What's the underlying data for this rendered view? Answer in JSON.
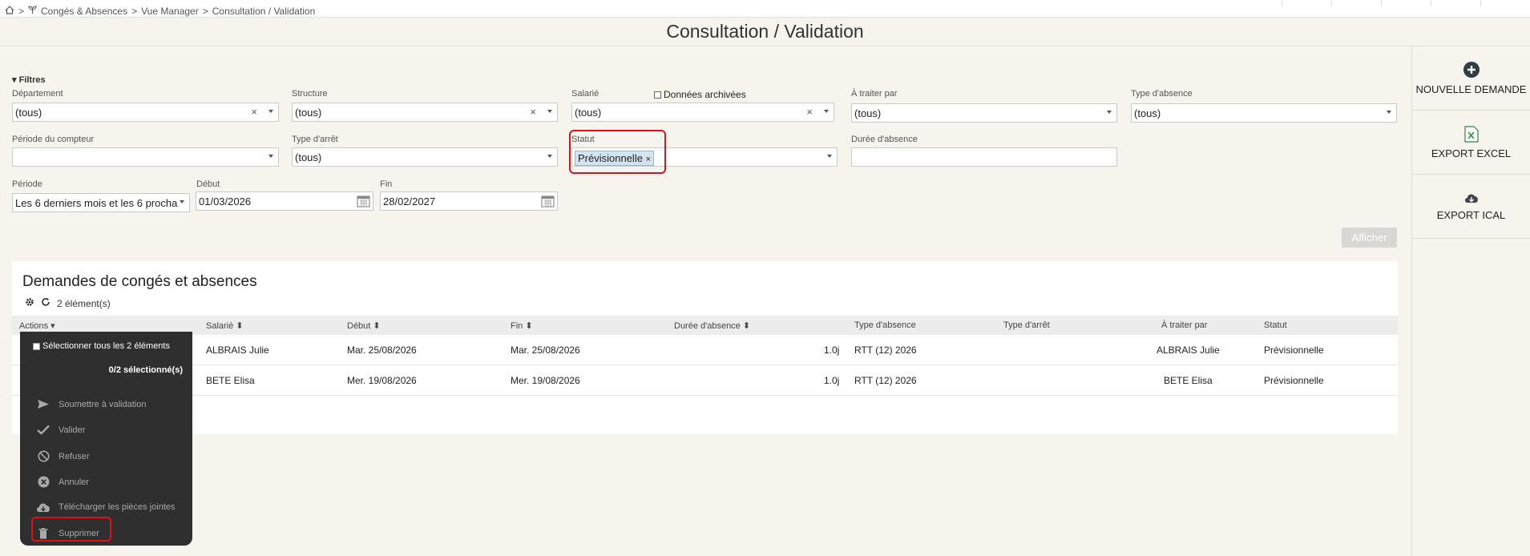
{
  "breadcrumb": {
    "separator": ">",
    "items": [
      "Congés & Absences",
      "Vue Manager",
      "Consultation / Validation"
    ]
  },
  "page": {
    "title": "Consultation / Validation"
  },
  "sidebar": {
    "new_request": "NOUVELLE DEMANDE",
    "export_excel": "EXPORT EXCEL",
    "export_ical": "EXPORT ICAL"
  },
  "filters": {
    "toggle_label": "Filtres",
    "departement": {
      "label": "Département",
      "value": "(tous)"
    },
    "structure": {
      "label": "Structure",
      "value": "(tous)"
    },
    "salarie": {
      "label": "Salarié",
      "value": "(tous)"
    },
    "archived": {
      "label": "Données archivées"
    },
    "a_traiter_par": {
      "label": "À traiter par",
      "value": "(tous)"
    },
    "type_absence": {
      "label": "Type d'absence",
      "value": "(tous)"
    },
    "periode_compteur": {
      "label": "Période du compteur",
      "value": ""
    },
    "type_arret": {
      "label": "Type d'arrêt",
      "value": "(tous)"
    },
    "statut": {
      "label": "Statut",
      "chip": "Prévisionnelle"
    },
    "duree_absence": {
      "label": "Durée d'absence",
      "value": ""
    },
    "periode": {
      "label": "Période",
      "value": "Les 6 derniers mois et les 6 procha"
    },
    "debut": {
      "label": "Début",
      "value": "01/03/2026"
    },
    "fin": {
      "label": "Fin",
      "value": "28/02/2027"
    },
    "submit": "Afficher"
  },
  "panel": {
    "title": "Demandes de congés et absences",
    "count": "2 élément(s)"
  },
  "table": {
    "headers": {
      "actions": "Actions",
      "salarie": "Salarié",
      "debut": "Début",
      "fin": "Fin",
      "duree": "Durée d'absence",
      "type_absence": "Type d'absence",
      "type_arret": "Type d'arrêt",
      "a_traiter": "À traiter par",
      "statut": "Statut"
    },
    "rows": [
      {
        "salarie": "ALBRAIS Julie",
        "debut": "Mar. 25/08/2026",
        "fin": "Mar. 25/08/2026",
        "duree": "1.0j",
        "type_absence": "RTT (12) 2026",
        "type_arret": "",
        "a_traiter": "ALBRAIS Julie",
        "statut": "Prévisionnelle"
      },
      {
        "salarie": "BETE Elisa",
        "debut": "Mer. 19/08/2026",
        "fin": "Mer. 19/08/2026",
        "duree": "1.0j",
        "type_absence": "RTT (12) 2026",
        "type_arret": "",
        "a_traiter": "BETE Elisa",
        "statut": "Prévisionnelle"
      }
    ]
  },
  "actions_menu": {
    "select_all": "Sélectionner tous les 2 éléments",
    "selected_count": "0/2 sélectionné(s)",
    "items": [
      "Soumettre à validation",
      "Valider",
      "Refuser",
      "Annuler",
      "Télécharger les pièces jointes",
      "Supprimer"
    ]
  },
  "colors": {
    "highlight": "#e0101a",
    "chip_bg": "#d4e3ee",
    "menu_bg": "#2f2f2f"
  }
}
